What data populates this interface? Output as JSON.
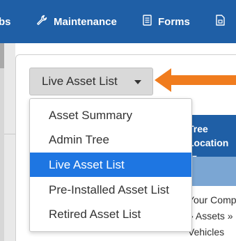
{
  "nav": {
    "partial_label": "bs",
    "maintenance_label": "Maintenance",
    "maintenance_icon": "wrench-icon",
    "forms_label": "Forms",
    "forms_icon": "form-document-icon",
    "next_icon": "document-icon"
  },
  "asset_view_select": {
    "selected_label": "Live Asset List",
    "caret_icon": "caret-down-icon"
  },
  "dropdown": {
    "items": [
      {
        "label": "Asset Summary"
      },
      {
        "label": "Admin Tree"
      },
      {
        "label": "Live Asset List",
        "selected": true
      },
      {
        "label": "Pre-Installed Asset List"
      },
      {
        "label": "Retired Asset List"
      }
    ]
  },
  "table": {
    "header_line1": "Tree",
    "header_line2": "Location",
    "filter_icon": "caret-down-icon",
    "cell_line1": "Your Comp",
    "cell_line2": "» Assets »",
    "cell_line3": "Vehicles"
  },
  "annotation": {
    "arrow_color": "#f07c1e"
  },
  "colors": {
    "nav_background": "#1f5fa6",
    "selected_item_background": "#1e76e2",
    "table_band": "#7ba6d3"
  }
}
